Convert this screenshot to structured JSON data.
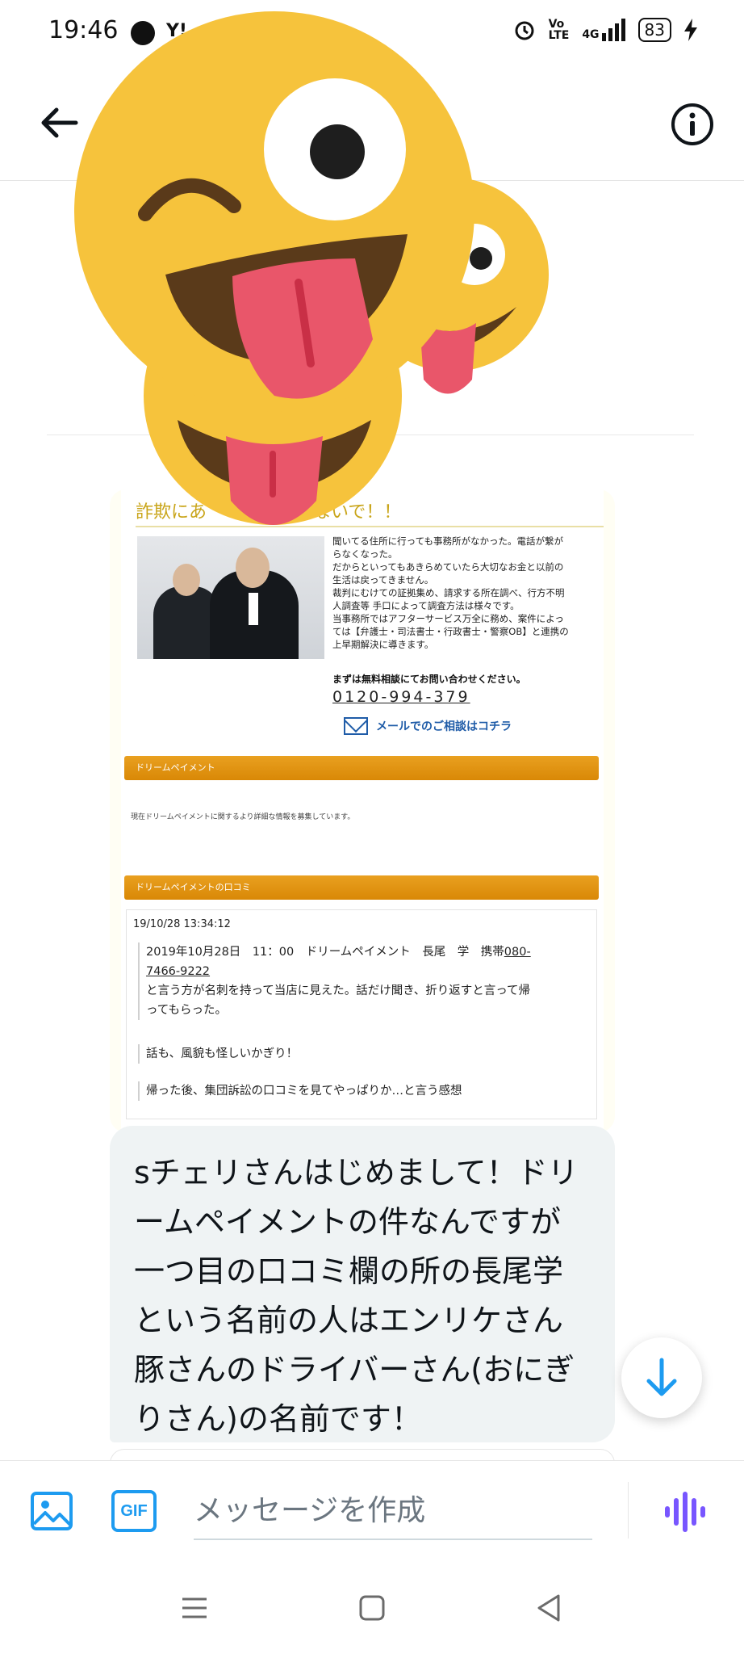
{
  "status_bar": {
    "time": "19:46",
    "app_icons": [
      "line-icon",
      "yahoo-icon"
    ],
    "indicators": [
      "alarm-icon",
      "volte-icon",
      "4g-signal-icon"
    ],
    "network": "4G",
    "battery": "83"
  },
  "header": {
    "back_icon": "arrow-left-icon",
    "info_icon": "info-icon"
  },
  "attached_image": {
    "title": "詐欺にあ　　　　　らないで！！",
    "body_lines": [
      "聞いてる住所に行っても事務所がなかった。電話が繋が",
      "らなくなった。",
      "だからといってもあきらめていたら大切なお金と以前の",
      "生活は戻ってきません。",
      "裁判にむけての証拠集め、請求する所在調べ、行方不明",
      "人調査等 手口によって調査方法は様々です。",
      "当事務所ではアフターサービス万全に務め、案件によっ",
      "ては【弁護士・司法書士・行政書士・警察OB】と連携の",
      "上早期解決に導きます。"
    ],
    "cta": "まずは無料相談にてお問い合わせください。",
    "phone": "0120-994-379",
    "mail_link": "メールでのご相談はコチラ",
    "section1": "ドリームペイメント",
    "section1_note": "現在ドリームペイメントに関するより詳細な情報を募集しています。",
    "section2": "ドリームペイメントの口コミ",
    "review": {
      "date": "19/10/28 13:34:12",
      "line1a": "2019年10月28日　11：00　ドリームペイメント　長尾　学　携帯",
      "line1b": "080-",
      "line1c": "7466-9222",
      "line1d": "と言う方が名刺を持って当店に見えた。話だけ聞き、折り返すと言って帰",
      "line1e": "ってもらった。",
      "line2": "話も、風貌も怪しいかぎり！",
      "line3": "帰った後、集団訴訟の口コミを見てやっぱりか…と言う感想"
    }
  },
  "sticker": {
    "icon": "laughing-emoji-sticker-icon"
  },
  "message": {
    "text": "sチェリさんはじめまして！ドリームペイメントの件なんですが一つ目の口コミ欄の所の長尾学という名前の人はエンリケさん豚さんのドライバーさん(おにぎりさん)の名前です！"
  },
  "composer": {
    "image_icon": "image-icon",
    "gif_label": "GIF",
    "placeholder": "メッセージを作成",
    "voice_icon": "voice-waveform-icon"
  },
  "nav": {
    "items": [
      "menu-icon",
      "home-square-icon",
      "back-triangle-icon"
    ]
  },
  "colors": {
    "accent": "#1d9bf0",
    "bubble": "#eff3f4",
    "voice": "#7856ff",
    "sticker_yellow": "#f6c33c",
    "tongue": "#e9566a"
  }
}
